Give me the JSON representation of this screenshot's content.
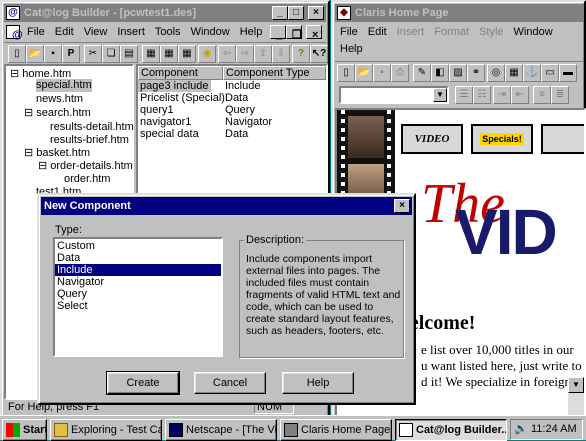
{
  "builder": {
    "title": "Cat@log Builder - [pcwtest1.des]",
    "menu": [
      "File",
      "Edit",
      "View",
      "Insert",
      "Tools",
      "Window",
      "Help"
    ],
    "tree": [
      {
        "label": "home.htm"
      },
      {
        "label": "special.htm"
      },
      {
        "label": "news.htm"
      },
      {
        "label": "search.htm"
      },
      {
        "label": "results-detail.htm"
      },
      {
        "label": "results-brief.htm"
      },
      {
        "label": "basket.htm"
      },
      {
        "label": "order-details.htm"
      },
      {
        "label": "order.htm"
      },
      {
        "label": "test1.htm"
      }
    ],
    "table_headers": [
      "Component",
      "Component Type"
    ],
    "rows": [
      {
        "component": "page3 include",
        "type": "Include"
      },
      {
        "component": "Pricelist (Special)",
        "type": "Data"
      },
      {
        "component": "query1",
        "type": "Query"
      },
      {
        "component": "navigator1",
        "type": "Navigator"
      },
      {
        "component": "special data",
        "type": "Data"
      }
    ],
    "status_left": "For Help, press F1",
    "status_right": "NUM"
  },
  "claris": {
    "title": "Claris Home Page",
    "menu1": [
      "File",
      "Edit",
      "Insert",
      "Format",
      "Style",
      "Window"
    ],
    "menu2": [
      "Help"
    ],
    "nav_video": "VIDEO",
    "nav_specials": "Specials!",
    "banner_the": "The",
    "banner_vid": "VID",
    "welcome": "Welcome!",
    "body_lines": [
      "e list over 10,000 titles in our",
      "u want listed here, just write to",
      "d it! We specialize in foreign"
    ]
  },
  "dialog": {
    "title": "New Component",
    "type_label": "Type:",
    "types": [
      "Custom",
      "Data",
      "Include",
      "Navigator",
      "Query",
      "Select"
    ],
    "selected_index": 2,
    "description_label": "Description:",
    "description": "Include components import external files into pages. The included files must contain fragments of  valid HTML text and code, which can be used to create standard layout features, such as headers, footers, etc.",
    "buttons": {
      "create": "Create",
      "cancel": "Cancel",
      "help": "Help"
    }
  },
  "taskbar": {
    "start": "Start",
    "items": [
      {
        "label": "Exploring - Test Cat..."
      },
      {
        "label": "Netscape - [The Vi..."
      },
      {
        "label": "Claris Home Page"
      },
      {
        "label": "Cat@log Builder..."
      }
    ],
    "time": "11:24 AM"
  }
}
